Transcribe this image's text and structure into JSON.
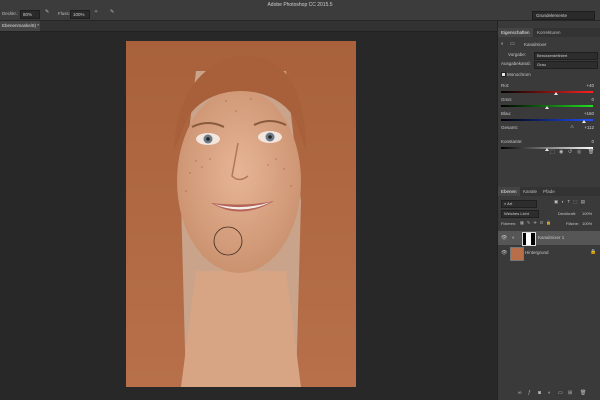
{
  "app": {
    "title": "Adobe Photoshop CC 2015.5"
  },
  "optbar": {
    "opacity_label": "Deckkr.:",
    "opacity_value": "80%",
    "flow_label": "Fluss:",
    "flow_value": "100%",
    "workspace": "Grundelemente"
  },
  "document": {
    "tab": "Ebenenmaske/8) *"
  },
  "properties": {
    "tabs": [
      "Eigenschaften",
      "Korrekturen"
    ],
    "header": "Kanalmixer",
    "preset_label": "Vorgabe:",
    "preset_value": "Benutzerdefiniert",
    "output_label": "Ausgabekanal:",
    "output_value": "Grau",
    "monochrome_label": "Monochrom",
    "sliders": [
      {
        "label": "Rot:",
        "value": "+40",
        "fraction": 0.6,
        "gradient": "linear-gradient(90deg,#000,#ff2020)"
      },
      {
        "label": "Grün:",
        "value": "0",
        "fraction": 0.5,
        "gradient": "linear-gradient(90deg,#000,#20e020)"
      },
      {
        "label": "Blau:",
        "value": "+160",
        "fraction": 0.9,
        "gradient": "linear-gradient(90deg,#000,#2050ff)"
      },
      {
        "label": "Gesamt:",
        "value": "+112",
        "fraction": 0.0,
        "gradient": "none"
      },
      {
        "label": "Konstante:",
        "value": "0",
        "fraction": 0.5,
        "gradient": "linear-gradient(90deg,#000,#fff)"
      }
    ],
    "total_warning": "⚠"
  },
  "layers": {
    "tabs": [
      "Ebenen",
      "Kanäle",
      "Pfade"
    ],
    "filter_label": "Art",
    "blend_mode": "Weiches Licht",
    "opacity_label": "Deckkraft:",
    "opacity_value": "100%",
    "lock_label": "Fixieren:",
    "fill_label": "Fläche:",
    "fill_value": "100%",
    "items": [
      {
        "name": "Kanalmixer 1"
      },
      {
        "name": "Hintergrund"
      }
    ]
  },
  "colors": {
    "accent": "#4a7fd6",
    "panel": "#3a3a3a",
    "canvas": "#282828"
  }
}
